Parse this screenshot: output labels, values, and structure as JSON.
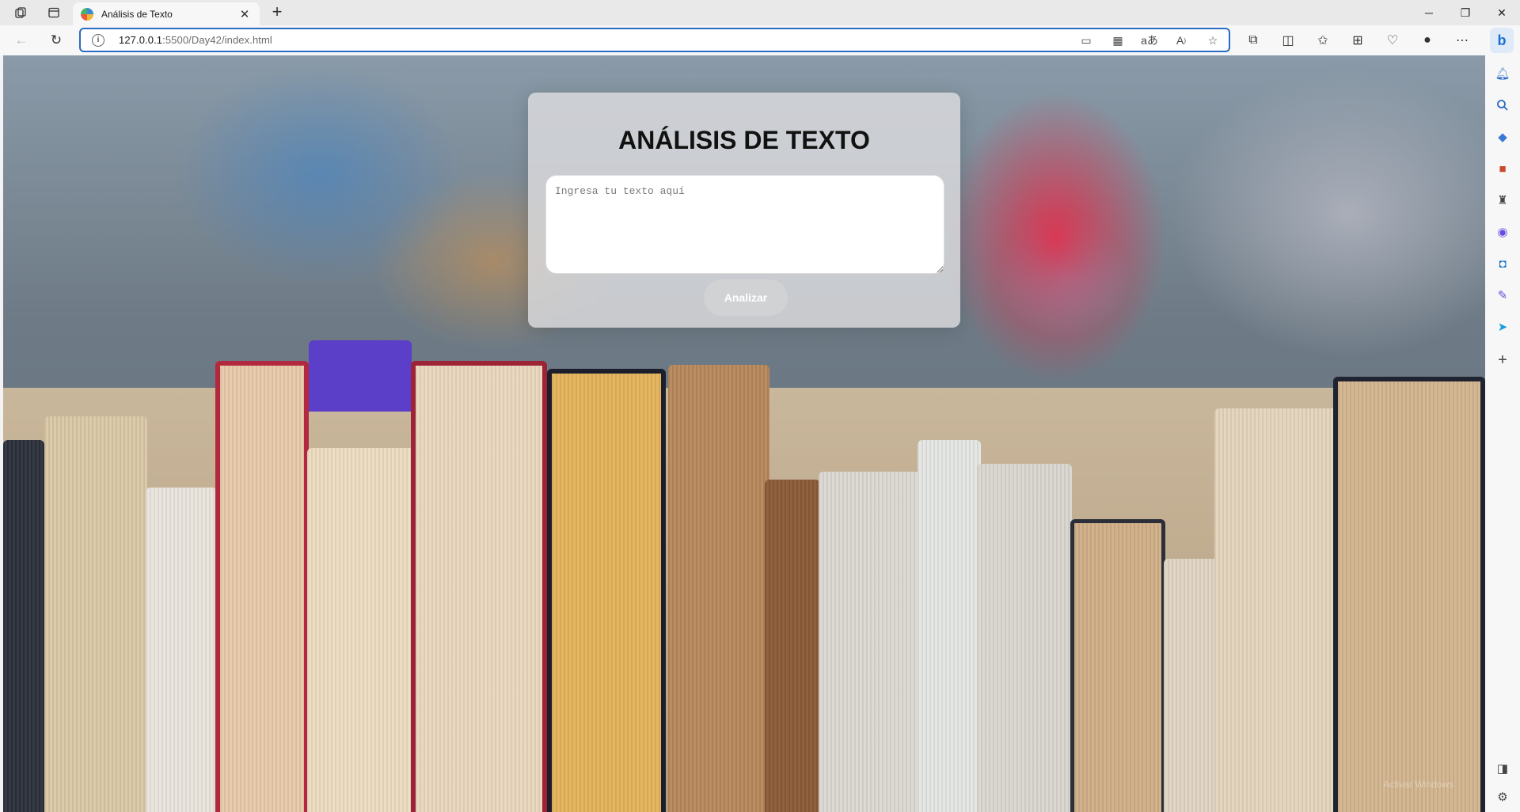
{
  "browser": {
    "tab_title": "Análisis de Texto",
    "url_host": "127.0.0.1",
    "url_rest": ":5500/Day42/index.html",
    "new_tab": "+",
    "icons": {
      "workspaces": "workspaces-icon",
      "tab_actions": "tab-actions-icon",
      "back": "back-arrow-icon",
      "refresh": "refresh-icon",
      "info": "info-icon"
    }
  },
  "page": {
    "title": "ANÁLISIS DE TEXTO",
    "textarea_placeholder": "Ingresa tu texto aquí",
    "textarea_value": "",
    "button_label": "Analizar",
    "watermark": "Activar Windows"
  },
  "colors": {
    "accent": "#2b6cc4",
    "card_bg": "#dcdcde"
  }
}
